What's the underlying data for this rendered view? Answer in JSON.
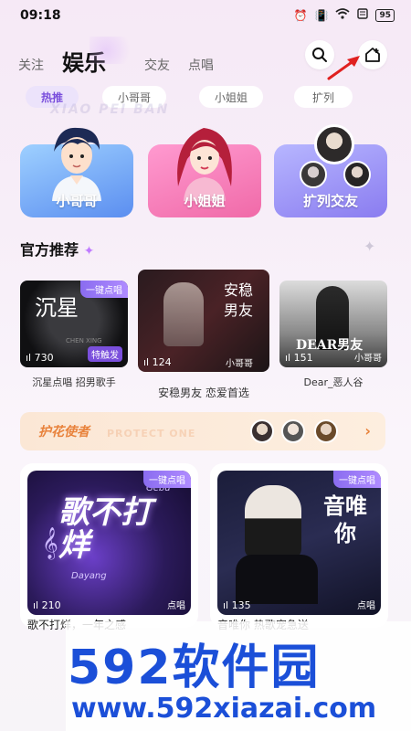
{
  "status": {
    "time": "09:18",
    "battery": "95"
  },
  "nav": {
    "tabs": [
      {
        "label": "关注"
      },
      {
        "label": "娱乐"
      },
      {
        "label": "交友"
      },
      {
        "label": "点唱"
      }
    ]
  },
  "chips": [
    "热推",
    "小哥哥",
    "小姐姐",
    "扩列"
  ],
  "bg_text": "XIAO PEI BAN",
  "categories": [
    {
      "label": "小哥哥"
    },
    {
      "label": "小姐姐"
    },
    {
      "label": "扩列交友"
    }
  ],
  "section": {
    "title": "官方推荐"
  },
  "recommended": [
    {
      "badge": "一键点唱",
      "cover_text": "沉星",
      "cover_sub": "CHEN XING",
      "count": "730",
      "tag": "特触发",
      "title": "沉星点唱 招男歌手"
    },
    {
      "cover_text": "安稳男友",
      "cover_sub": "小哥哥",
      "count": "124",
      "title": "安稳男友 恋爱首选"
    },
    {
      "cover_text": "DEAR男友",
      "cover_sub": "小哥哥",
      "count": "151",
      "title": "Dear_恶人谷"
    }
  ],
  "banner": {
    "title": "护花使者",
    "ghost": "PROTECT ONE"
  },
  "big_cards": [
    {
      "badge": "一键点唱",
      "cover_text": "歌不打烊",
      "cover_en": "Gebu",
      "cover_en2": "Dayang",
      "count": "210",
      "tag": "点唱",
      "title": "歌不打烊，一年之感"
    },
    {
      "badge": "一键点唱",
      "cover_text": "音唯你",
      "count": "135",
      "tag": "点唱",
      "title": "音唯你 热歌宠急送"
    }
  ],
  "watermark": {
    "brand": "592软件园",
    "url": "www.592xiazai.com"
  }
}
